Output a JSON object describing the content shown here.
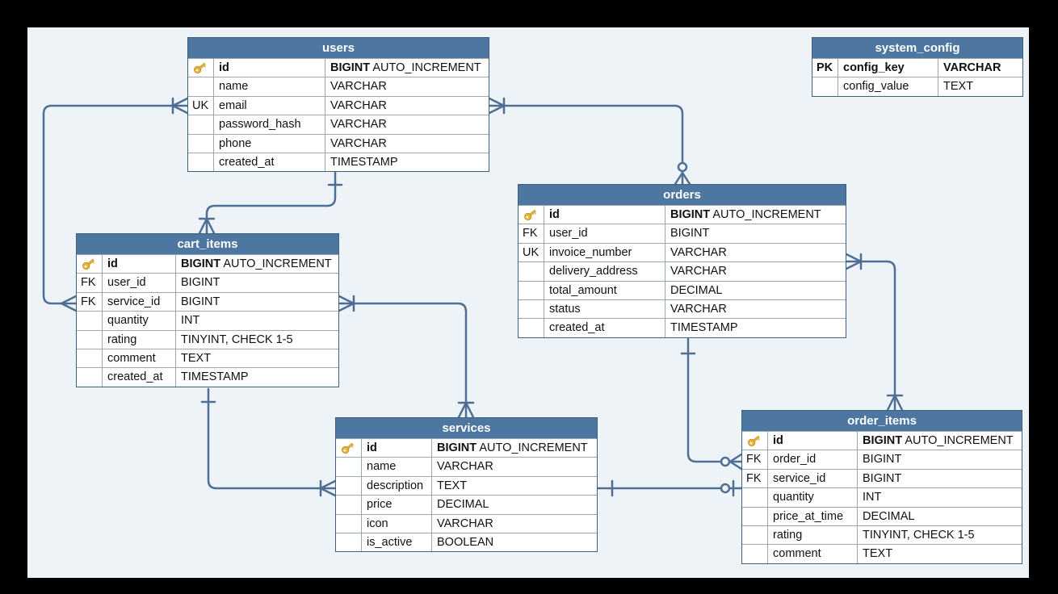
{
  "tables": {
    "users": {
      "title": "users",
      "rows": [
        {
          "key": "",
          "name": "id",
          "type_bold": "BIGINT",
          "type": " AUTO_INCREMENT"
        },
        {
          "key": "",
          "name": "name",
          "type": "VARCHAR"
        },
        {
          "key": "UK",
          "name": "email",
          "type": "VARCHAR"
        },
        {
          "key": "",
          "name": "password_hash",
          "type": "VARCHAR"
        },
        {
          "key": "",
          "name": "phone",
          "type": "VARCHAR"
        },
        {
          "key": "",
          "name": "created_at",
          "type": "TIMESTAMP"
        }
      ]
    },
    "system_config": {
      "title": "system_config",
      "rows": [
        {
          "key": "PK",
          "name": "config_key",
          "type_bold": "VARCHAR",
          "type": ""
        },
        {
          "key": "",
          "name": "config_value",
          "type": "TEXT"
        }
      ]
    },
    "orders": {
      "title": "orders",
      "rows": [
        {
          "key": "",
          "name": "id",
          "type_bold": "BIGINT",
          "type": " AUTO_INCREMENT"
        },
        {
          "key": "FK",
          "name": "user_id",
          "type": "BIGINT"
        },
        {
          "key": "UK",
          "name": "invoice_number",
          "type": "VARCHAR"
        },
        {
          "key": "",
          "name": "delivery_address",
          "type": "VARCHAR"
        },
        {
          "key": "",
          "name": "total_amount",
          "type": "DECIMAL"
        },
        {
          "key": "",
          "name": "status",
          "type": "VARCHAR"
        },
        {
          "key": "",
          "name": "created_at",
          "type": "TIMESTAMP"
        }
      ]
    },
    "cart_items": {
      "title": "cart_items",
      "rows": [
        {
          "key": "",
          "name": "id",
          "type_bold": "BIGINT",
          "type": " AUTO_INCREMENT"
        },
        {
          "key": "FK",
          "name": "user_id",
          "type": "BIGINT"
        },
        {
          "key": "FK",
          "name": "service_id",
          "type": "BIGINT"
        },
        {
          "key": "",
          "name": "quantity",
          "type": "INT"
        },
        {
          "key": "",
          "name": "rating",
          "type": "TINYINT, CHECK 1-5"
        },
        {
          "key": "",
          "name": "comment",
          "type": "TEXT"
        },
        {
          "key": "",
          "name": "created_at",
          "type": "TIMESTAMP"
        }
      ]
    },
    "services": {
      "title": "services",
      "rows": [
        {
          "key": "",
          "name": "id",
          "type_bold": "BIGINT",
          "type": " AUTO_INCREMENT"
        },
        {
          "key": "",
          "name": "name",
          "type": "VARCHAR"
        },
        {
          "key": "",
          "name": "description",
          "type": "TEXT"
        },
        {
          "key": "",
          "name": "price",
          "type": "DECIMAL"
        },
        {
          "key": "",
          "name": "icon",
          "type": "VARCHAR"
        },
        {
          "key": "",
          "name": "is_active",
          "type": "BOOLEAN"
        }
      ]
    },
    "order_items": {
      "title": "order_items",
      "rows": [
        {
          "key": "",
          "name": "id",
          "type_bold": "BIGINT",
          "type": " AUTO_INCREMENT"
        },
        {
          "key": "FK",
          "name": "order_id",
          "type": "BIGINT"
        },
        {
          "key": "FK",
          "name": "service_id",
          "type": "BIGINT"
        },
        {
          "key": "",
          "name": "quantity",
          "type": "INT"
        },
        {
          "key": "",
          "name": "price_at_time",
          "type": "DECIMAL"
        },
        {
          "key": "",
          "name": "rating",
          "type": "TINYINT, CHECK 1-5"
        },
        {
          "key": "",
          "name": "comment",
          "type": "TEXT"
        }
      ]
    }
  },
  "relationships": [
    {
      "from": "users",
      "to": "cart_items",
      "notation": "one-to-many"
    },
    {
      "from": "users",
      "to": "cart_items",
      "notation": "many"
    },
    {
      "from": "users",
      "to": "orders",
      "notation": "one-to-zero-or-many"
    },
    {
      "from": "orders",
      "to": "order_items",
      "notation": "one-to-many"
    },
    {
      "from": "orders",
      "to": "order_items",
      "notation": "one-to-zero-or-many"
    },
    {
      "from": "cart_items",
      "to": "services",
      "notation": "many-to-many"
    },
    {
      "from": "cart_items",
      "to": "services",
      "notation": "one-to-many"
    },
    {
      "from": "services",
      "to": "order_items",
      "notation": "one-to-zero"
    }
  ],
  "colors": {
    "header": "#4d76a0",
    "line": "#4e6f93",
    "key_icon": "#e8b53a",
    "background": "#eef3f8",
    "frame": "#000000"
  },
  "icons": {
    "primary_key": "key-icon"
  }
}
